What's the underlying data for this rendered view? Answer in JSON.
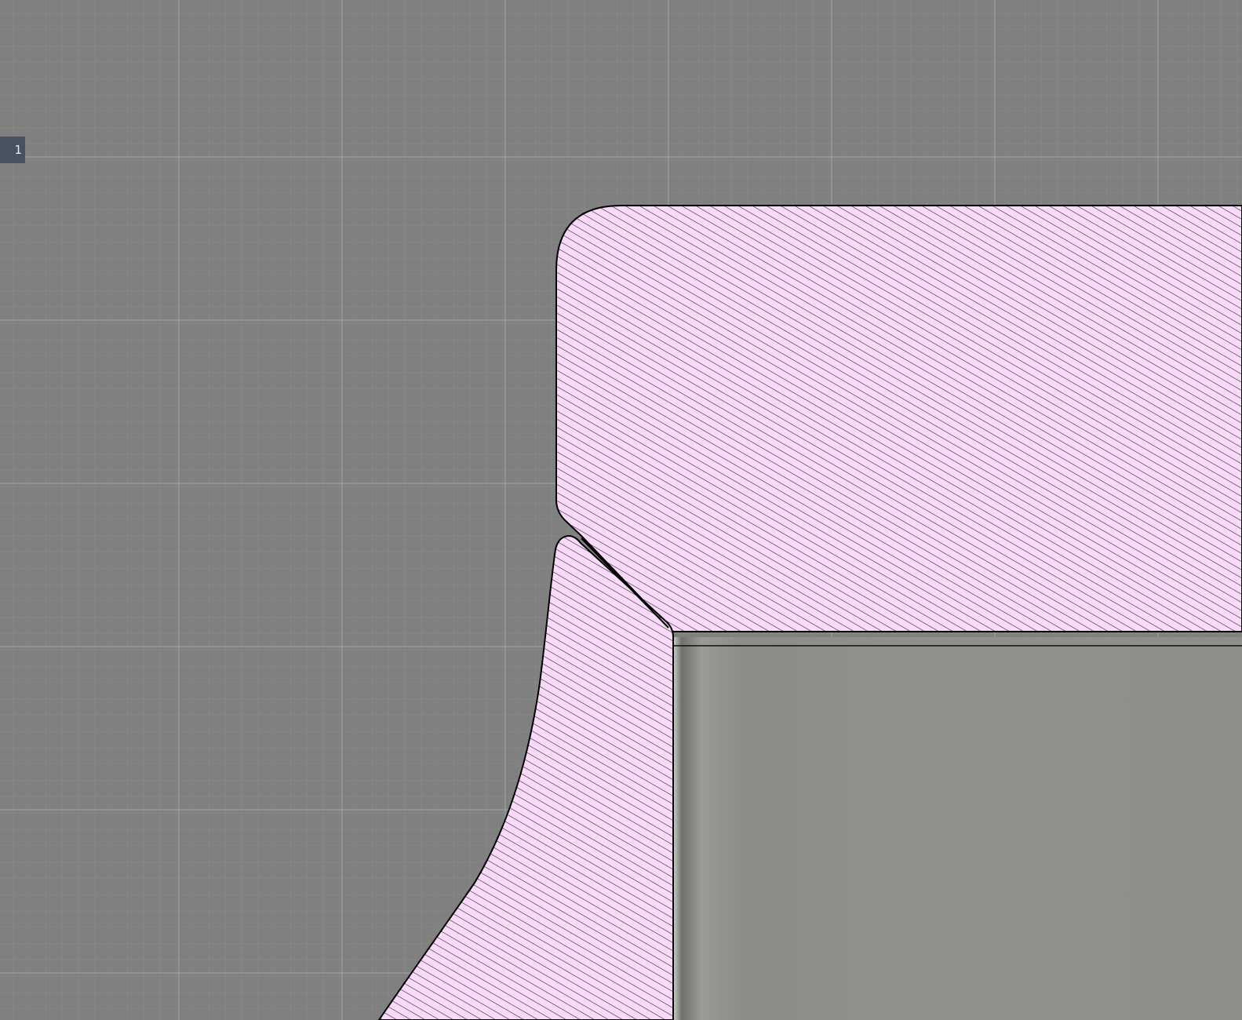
{
  "viewport": {
    "background_color": "#808080",
    "grid_minor_color": "#8a8a8a",
    "grid_major_color": "#a3a3a3",
    "view_label": "1"
  },
  "section_view": {
    "hatch_fill_color": "#fad9fa",
    "hatch_line_color": "#000000",
    "outline_color": "#000000",
    "solid_body_color": "#8e8e8a"
  }
}
